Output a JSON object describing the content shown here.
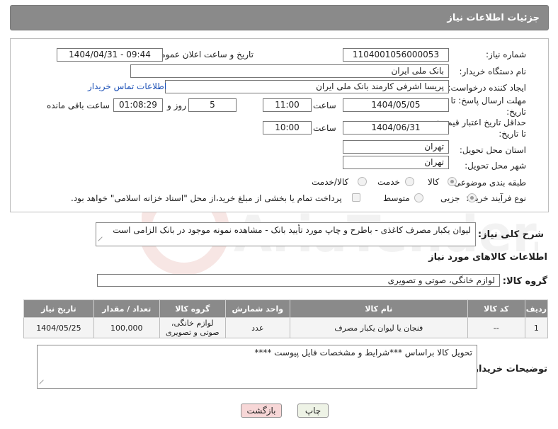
{
  "header": {
    "title": "جزئیات اطلاعات نیاز"
  },
  "form": {
    "need_number": {
      "label": "شماره نیاز:",
      "value": "1104001056000053"
    },
    "announce": {
      "label": "تاریخ و ساعت اعلان عمومی:",
      "value": "1404/04/31 - 09:44"
    },
    "buyer_org": {
      "label": "نام دستگاه خریدار:",
      "value": "بانک ملی ایران"
    },
    "requester": {
      "label": "ایجاد کننده درخواست:",
      "value": "پریسا اشرفی کارمند بانک ملی ایران",
      "contact_link": "اطلاعات تماس خریدار"
    },
    "reply_deadline": {
      "label_line1": "مهلت ارسال پاسخ: تا",
      "label_line2": "تاریخ:",
      "date": "1404/05/05",
      "time_label": "ساعت",
      "time": "11:00",
      "days": "5",
      "days_label": "روز و",
      "remaining": "01:08:29",
      "remaining_label": "ساعت باقی مانده"
    },
    "price_validity": {
      "label_line1": "حداقل تاریخ اعتبار قیمت:",
      "label_line2": "تا تاریخ:",
      "date": "1404/06/31",
      "time_label": "ساعت",
      "time": "10:00"
    },
    "province": {
      "label": "استان محل تحویل:",
      "value": "تهران"
    },
    "city": {
      "label": "شهر محل تحویل:",
      "value": "تهران"
    },
    "category": {
      "label": "طبقه بندی موضوعی:",
      "options": [
        "کالا",
        "خدمت",
        "کالا/خدمت"
      ],
      "selected": "کالا"
    },
    "process": {
      "label": "نوع فرآیند خرید :",
      "options": [
        "جزیی",
        "متوسط"
      ],
      "selected": "جزیی",
      "payment_note": "پرداخت تمام یا بخشی از مبلغ خرید،از محل \"اسناد خزانه اسلامی\" خواهد بود."
    }
  },
  "description": {
    "label": "شرح کلی نیاز:",
    "value": "لیوان یکبار مصرف کاغذی - باطرح و چاپ مورد تأیید بانک - مشاهده نمونه موجود در بانک الزامی است"
  },
  "goods_section": {
    "title": "اطلاعات کالاهای مورد نیاز",
    "group_label": "گروه کالا:",
    "group_value": "لوازم خانگی، صوتی و تصویری"
  },
  "table": {
    "headers": [
      "ردیف",
      "کد کالا",
      "نام کالا",
      "واحد شمارش",
      "گروه کالا",
      "تعداد / مقدار",
      "تاریخ نیاز"
    ],
    "rows": [
      {
        "index": "1",
        "code": "--",
        "name": "فنجان یا لیوان یکبار مصرف",
        "unit": "عدد",
        "group": "لوازم خانگی، صوتی و تصویری",
        "qty": "100,000",
        "date": "1404/05/25"
      }
    ]
  },
  "buyer_notes": {
    "label": "توضیحات خریدار:",
    "value": "تحویل کالا براساس ***شرایط و مشخصات فایل پیوست ****"
  },
  "buttons": {
    "print": "چاپ",
    "back": "بازگشت"
  },
  "watermark": {
    "text": "AriaTender.net"
  },
  "colors": {
    "header_bg": "#8a8a8a",
    "link": "#1a4fb6",
    "back_button": "#f7d7d7",
    "print_button": "#eef3e6"
  }
}
